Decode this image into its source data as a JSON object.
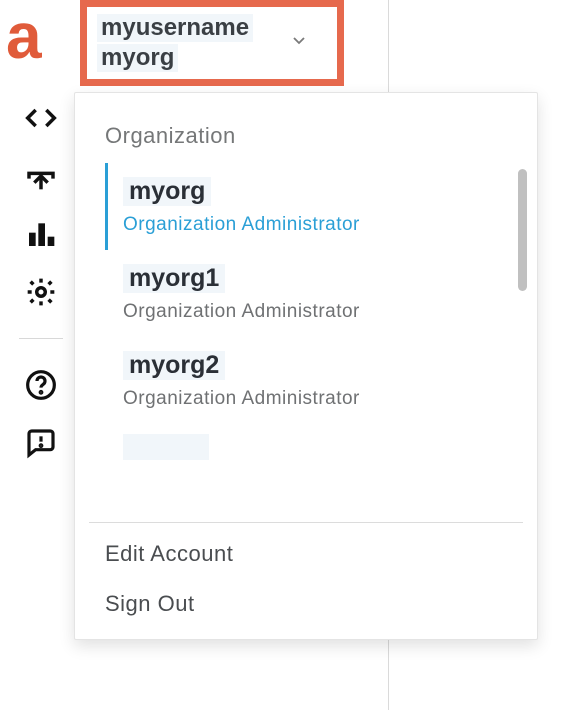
{
  "logo": {
    "text": "a"
  },
  "account": {
    "username": "myusername",
    "current_org": "myorg"
  },
  "dropdown": {
    "section_label": "Organization",
    "orgs": [
      {
        "name": "myorg",
        "role": "Organization Administrator",
        "selected": true
      },
      {
        "name": "myorg1",
        "role": "Organization Administrator",
        "selected": false
      },
      {
        "name": "myorg2",
        "role": "Organization Administrator",
        "selected": false
      }
    ],
    "edit_account_label": "Edit Account",
    "sign_out_label": "Sign Out"
  },
  "icons": {
    "code": "code-icon",
    "upload": "upload-icon",
    "chart": "chart-icon",
    "settings": "settings-icon",
    "help": "help-icon",
    "feedback": "feedback-icon",
    "chevron": "chevron-down-icon"
  }
}
